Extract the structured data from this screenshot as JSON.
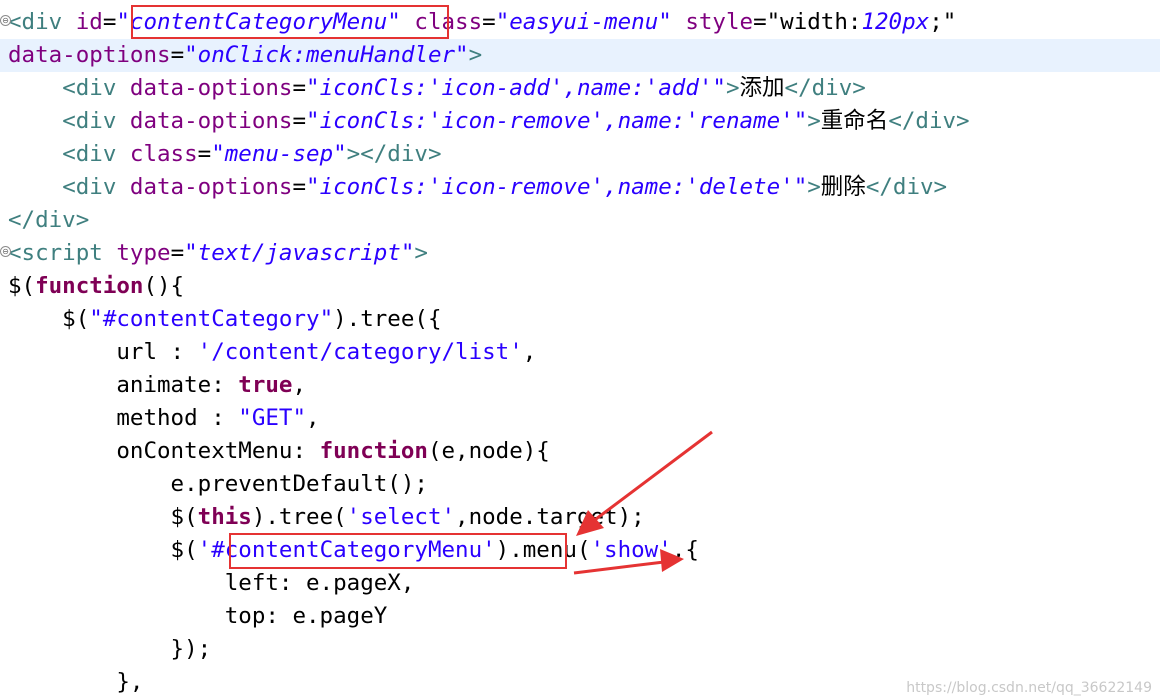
{
  "colors": {
    "tag": "#3f7f7f",
    "attr": "#7f007f",
    "value": "#2a00ff",
    "keyword": "#7f0055",
    "string": "#2a00ff",
    "plain": "#000000",
    "highlight_bg": "#e8f2fe",
    "annotation": "#e53333"
  },
  "code_lines": [
    {
      "hl": false,
      "fold": true,
      "tokens": [
        {
          "t": "<",
          "c": "tag"
        },
        {
          "t": "div",
          "c": "tag"
        },
        {
          "t": " id",
          "c": "attr"
        },
        {
          "t": "=",
          "c": "plain"
        },
        {
          "t": "\"contentCategoryMenu\"",
          "c": "value",
          "i": true
        },
        {
          "t": " class",
          "c": "attr"
        },
        {
          "t": "=",
          "c": "plain"
        },
        {
          "t": "\"easyui-menu\"",
          "c": "value",
          "i": true
        },
        {
          "t": " style",
          "c": "attr"
        },
        {
          "t": "=",
          "c": "plain"
        },
        {
          "t": "\"width:",
          "c": "plain"
        },
        {
          "t": "120px",
          "c": "value",
          "i": true
        },
        {
          "t": ";\"",
          "c": "plain"
        }
      ]
    },
    {
      "hl": true,
      "fold": false,
      "tokens": [
        {
          "t": "data-options",
          "c": "attr"
        },
        {
          "t": "=",
          "c": "plain"
        },
        {
          "t": "\"onClick:menuHandler\"",
          "c": "value",
          "i": true
        },
        {
          "t": ">",
          "c": "tag"
        }
      ]
    },
    {
      "hl": false,
      "fold": false,
      "tokens": [
        {
          "t": "    ",
          "c": "plain"
        },
        {
          "t": "<div",
          "c": "tag"
        },
        {
          "t": " data-options",
          "c": "attr"
        },
        {
          "t": "=",
          "c": "plain"
        },
        {
          "t": "\"iconCls:'icon-add',name:'add'\"",
          "c": "value",
          "i": true
        },
        {
          "t": ">",
          "c": "tag"
        },
        {
          "t": "添加",
          "c": "plain"
        },
        {
          "t": "</div>",
          "c": "tag"
        }
      ]
    },
    {
      "hl": false,
      "fold": false,
      "tokens": [
        {
          "t": "    ",
          "c": "plain"
        },
        {
          "t": "<div",
          "c": "tag"
        },
        {
          "t": " data-options",
          "c": "attr"
        },
        {
          "t": "=",
          "c": "plain"
        },
        {
          "t": "\"iconCls:'icon-remove',name:'rename'\"",
          "c": "value",
          "i": true
        },
        {
          "t": ">",
          "c": "tag"
        },
        {
          "t": "重命名",
          "c": "plain"
        },
        {
          "t": "</div>",
          "c": "tag"
        }
      ]
    },
    {
      "hl": false,
      "fold": false,
      "tokens": [
        {
          "t": "    ",
          "c": "plain"
        },
        {
          "t": "<div",
          "c": "tag"
        },
        {
          "t": " class",
          "c": "attr"
        },
        {
          "t": "=",
          "c": "plain"
        },
        {
          "t": "\"menu-sep\"",
          "c": "value",
          "i": true
        },
        {
          "t": "></div>",
          "c": "tag"
        }
      ]
    },
    {
      "hl": false,
      "fold": false,
      "tokens": [
        {
          "t": "    ",
          "c": "plain"
        },
        {
          "t": "<div",
          "c": "tag"
        },
        {
          "t": " data-options",
          "c": "attr"
        },
        {
          "t": "=",
          "c": "plain"
        },
        {
          "t": "\"iconCls:'icon-remove',name:'delete'\"",
          "c": "value",
          "i": true
        },
        {
          "t": ">",
          "c": "tag"
        },
        {
          "t": "删除",
          "c": "plain"
        },
        {
          "t": "</div>",
          "c": "tag"
        }
      ]
    },
    {
      "hl": false,
      "fold": false,
      "tokens": [
        {
          "t": "</div>",
          "c": "tag"
        }
      ]
    },
    {
      "hl": false,
      "fold": true,
      "tokens": [
        {
          "t": "<script",
          "c": "tag"
        },
        {
          "t": " type",
          "c": "attr"
        },
        {
          "t": "=",
          "c": "plain"
        },
        {
          "t": "\"text/javascript\"",
          "c": "value",
          "i": true
        },
        {
          "t": ">",
          "c": "tag"
        }
      ]
    },
    {
      "hl": false,
      "fold": false,
      "tokens": [
        {
          "t": "$(",
          "c": "plain"
        },
        {
          "t": "function",
          "c": "keyword",
          "b": true
        },
        {
          "t": "(){",
          "c": "plain"
        }
      ]
    },
    {
      "hl": false,
      "fold": false,
      "tokens": [
        {
          "t": "    $(",
          "c": "plain"
        },
        {
          "t": "\"#contentCategory\"",
          "c": "string"
        },
        {
          "t": ").tree({",
          "c": "plain"
        }
      ]
    },
    {
      "hl": false,
      "fold": false,
      "tokens": [
        {
          "t": "        url : ",
          "c": "plain"
        },
        {
          "t": "'/content/category/list'",
          "c": "string"
        },
        {
          "t": ",",
          "c": "plain"
        }
      ]
    },
    {
      "hl": false,
      "fold": false,
      "tokens": [
        {
          "t": "        animate: ",
          "c": "plain"
        },
        {
          "t": "true",
          "c": "keyword",
          "b": true
        },
        {
          "t": ",",
          "c": "plain"
        }
      ]
    },
    {
      "hl": false,
      "fold": false,
      "tokens": [
        {
          "t": "        method : ",
          "c": "plain"
        },
        {
          "t": "\"GET\"",
          "c": "string"
        },
        {
          "t": ",",
          "c": "plain"
        }
      ]
    },
    {
      "hl": false,
      "fold": false,
      "tokens": [
        {
          "t": "        onContextMenu: ",
          "c": "plain"
        },
        {
          "t": "function",
          "c": "keyword",
          "b": true
        },
        {
          "t": "(e,node){",
          "c": "plain"
        }
      ]
    },
    {
      "hl": false,
      "fold": false,
      "tokens": [
        {
          "t": "            e.preventDefault();",
          "c": "plain"
        }
      ]
    },
    {
      "hl": false,
      "fold": false,
      "tokens": [
        {
          "t": "            $(",
          "c": "plain"
        },
        {
          "t": "this",
          "c": "keyword",
          "b": true
        },
        {
          "t": ").tree(",
          "c": "plain"
        },
        {
          "t": "'select'",
          "c": "string"
        },
        {
          "t": ",node.target);",
          "c": "plain"
        }
      ]
    },
    {
      "hl": false,
      "fold": false,
      "tokens": [
        {
          "t": "            $(",
          "c": "plain"
        },
        {
          "t": "'#contentCategoryMenu'",
          "c": "string"
        },
        {
          "t": ").menu(",
          "c": "plain"
        },
        {
          "t": "'show'",
          "c": "string"
        },
        {
          "t": ",{",
          "c": "plain"
        }
      ]
    },
    {
      "hl": false,
      "fold": false,
      "tokens": [
        {
          "t": "                left: e.pageX,",
          "c": "plain"
        }
      ]
    },
    {
      "hl": false,
      "fold": false,
      "tokens": [
        {
          "t": "                top: e.pageY",
          "c": "plain"
        }
      ]
    },
    {
      "hl": false,
      "fold": false,
      "tokens": [
        {
          "t": "            });",
          "c": "plain"
        }
      ]
    },
    {
      "hl": false,
      "fold": false,
      "tokens": [
        {
          "t": "        },",
          "c": "plain"
        }
      ]
    }
  ],
  "fold_glyph": "⊖",
  "watermark": "https://blog.csdn.net/qq_36622149"
}
